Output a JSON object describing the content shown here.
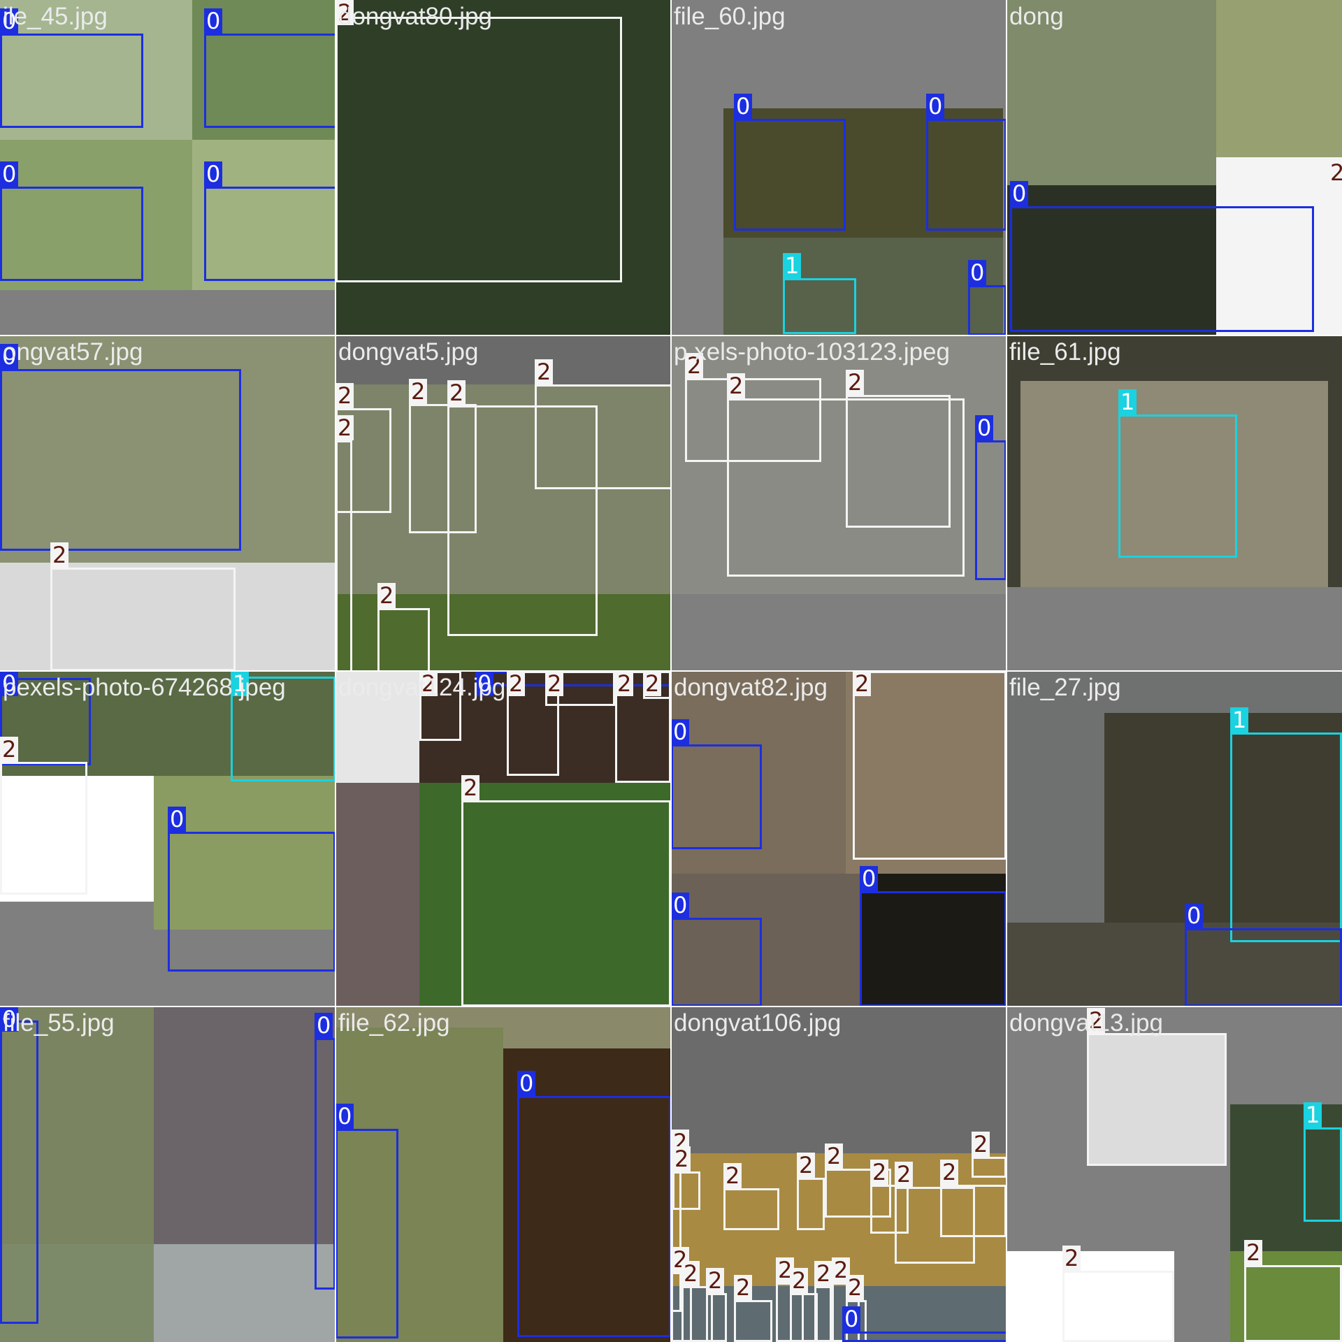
{
  "colors": {
    "class_0": "#1c2ee0",
    "class_1": "#1ad2e0",
    "class_2": "#f4f4f4",
    "letterbox": "#7f7f7f",
    "label_text": "#ebebeb"
  },
  "tiles": [
    {
      "label": "ile_45.jpg",
      "tags": [
        "0",
        "0",
        "0",
        "0"
      ]
    },
    {
      "label": "dongvat80.jpg",
      "tags": [
        "2"
      ]
    },
    {
      "label": "file_60.jpg",
      "tags": [
        "0",
        "0",
        "1",
        "0"
      ]
    },
    {
      "label": "dong",
      "tags": [
        "0",
        "2"
      ]
    },
    {
      "label": "ongvat57.jpg",
      "tags": [
        "0",
        "2"
      ]
    },
    {
      "label": "dongvat5.jpg",
      "tags": [
        "2",
        "2",
        "2",
        "2",
        "2",
        "2"
      ]
    },
    {
      "label": "p xels-photo-103123.jpeg",
      "tags": [
        "2",
        "2",
        "2",
        "0"
      ]
    },
    {
      "label": "file_61.jpg",
      "tags": [
        "1"
      ]
    },
    {
      "label": "pexels-photo-674268.jpeg",
      "tags": [
        "0",
        "1",
        "2",
        "0"
      ]
    },
    {
      "label": "dongvat124.jpg",
      "tags": [
        "2",
        "0",
        "2",
        "2",
        "2",
        "2",
        "2"
      ]
    },
    {
      "label": "dongvat82.jpg",
      "tags": [
        "2",
        "0",
        "0",
        "0"
      ]
    },
    {
      "label": "file_27.jpg",
      "tags": [
        "1",
        "0"
      ]
    },
    {
      "label": "file_55.jpg",
      "tags": [
        "0",
        "0"
      ]
    },
    {
      "label": "file_62.jpg",
      "tags": [
        "0",
        "0"
      ]
    },
    {
      "label": "dongvat106.jpg",
      "tags": [
        "2",
        "2",
        "2",
        "2",
        "2",
        "2",
        "2",
        "2",
        "2",
        "2",
        "2",
        "2",
        "2",
        "2",
        "2",
        "2",
        "2",
        "2",
        "0"
      ]
    },
    {
      "label": "dongvat13.jpg",
      "tags": [
        "2",
        "1",
        "2",
        "2"
      ]
    }
  ]
}
